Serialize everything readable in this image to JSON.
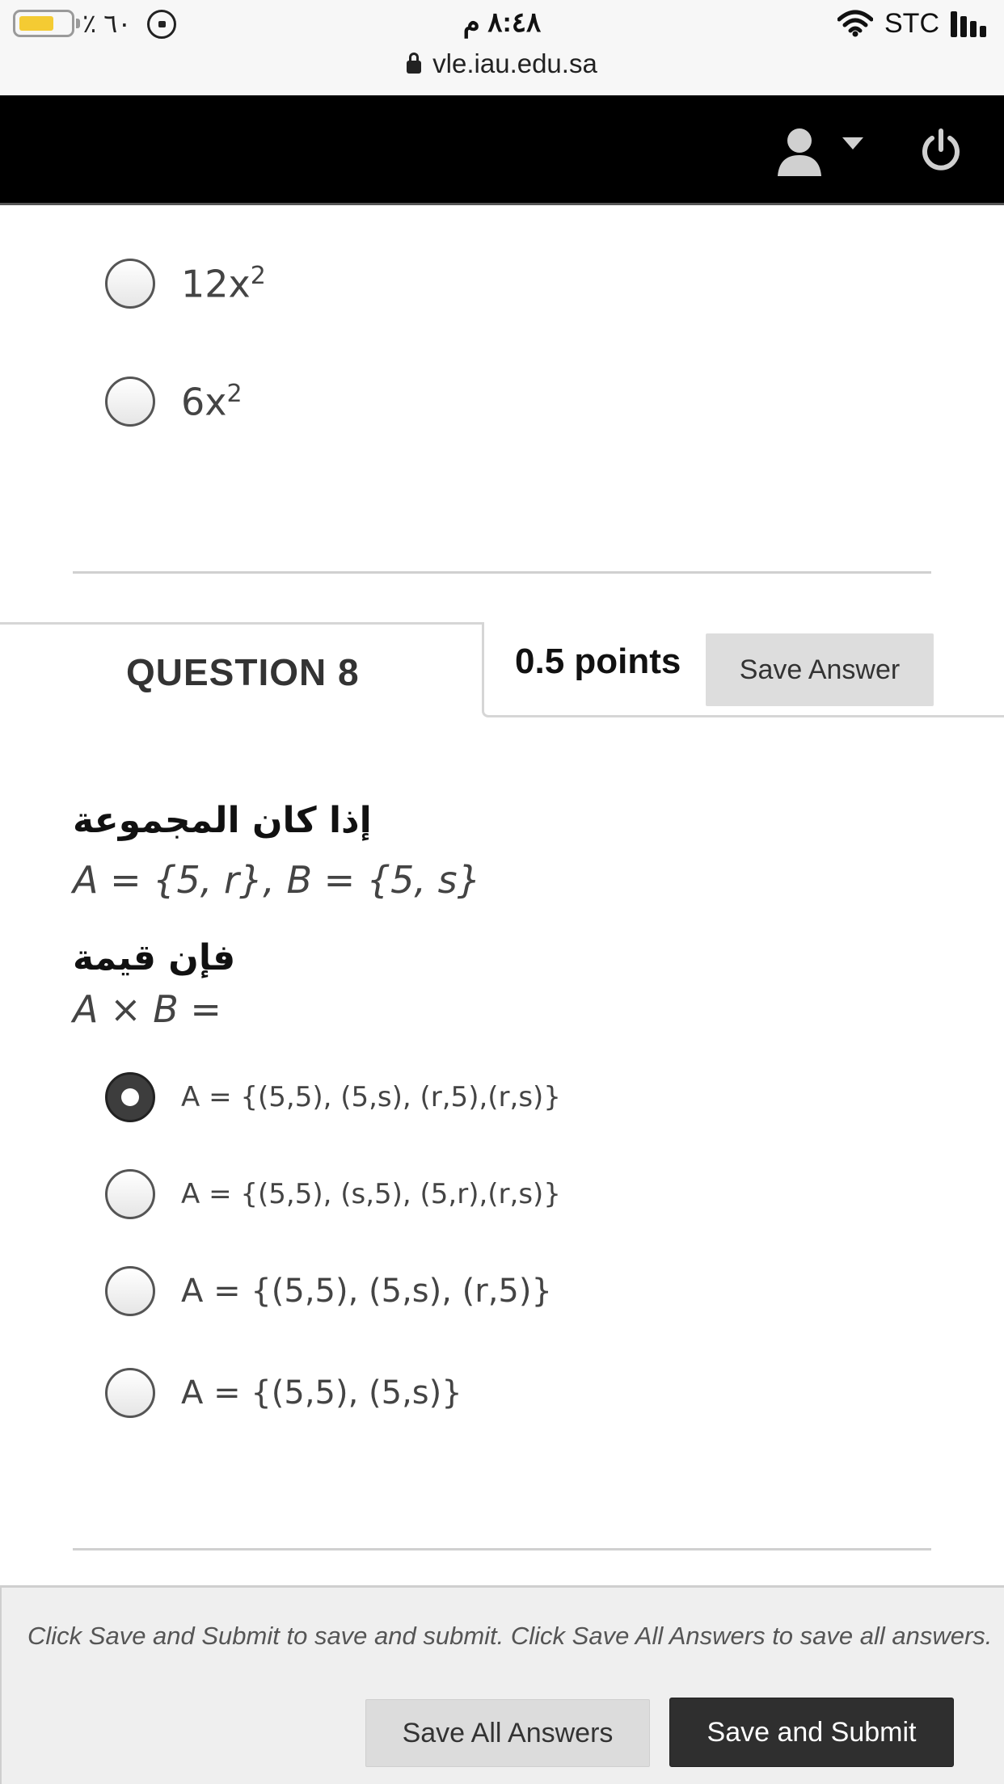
{
  "status_bar": {
    "battery_percent": "٪ ٦٠",
    "battery_level": 0.6,
    "time": "٨:٤٨ م",
    "url": "vle.iau.edu.sa",
    "carrier": "STC"
  },
  "header": {
    "user_menu_icon": "user-icon",
    "power_icon": "power-icon"
  },
  "prev_question": {
    "options": [
      {
        "base": "12x",
        "exp": "2",
        "selected": false
      },
      {
        "base": "6x",
        "exp": "2",
        "selected": false
      }
    ]
  },
  "question": {
    "title": "QUESTION 8",
    "points": "0.5 points",
    "save_label": "Save Answer",
    "line1_ar": "إذا كان المجموعة",
    "line1_math": "A = {5, r}, B = {5, s}",
    "line2_ar": "فإن قيمة",
    "line2_math": "A × B =",
    "options": [
      {
        "text": "A = {(5,5), (5,s), (r,5),(r,s)}",
        "selected": true
      },
      {
        "text": "A = {(5,5), (s,5), (5,r),(r,s)}",
        "selected": false
      },
      {
        "text": "A = {(5,5), (5,s), (r,5)}",
        "selected": false
      },
      {
        "text": "A = {(5,5), (5,s)}",
        "selected": false
      }
    ]
  },
  "footer": {
    "note": "Click Save and Submit to save and submit. Click Save All Answers to save all answers.",
    "save_all_label": "Save All Answers",
    "submit_label": "Save and Submit"
  }
}
